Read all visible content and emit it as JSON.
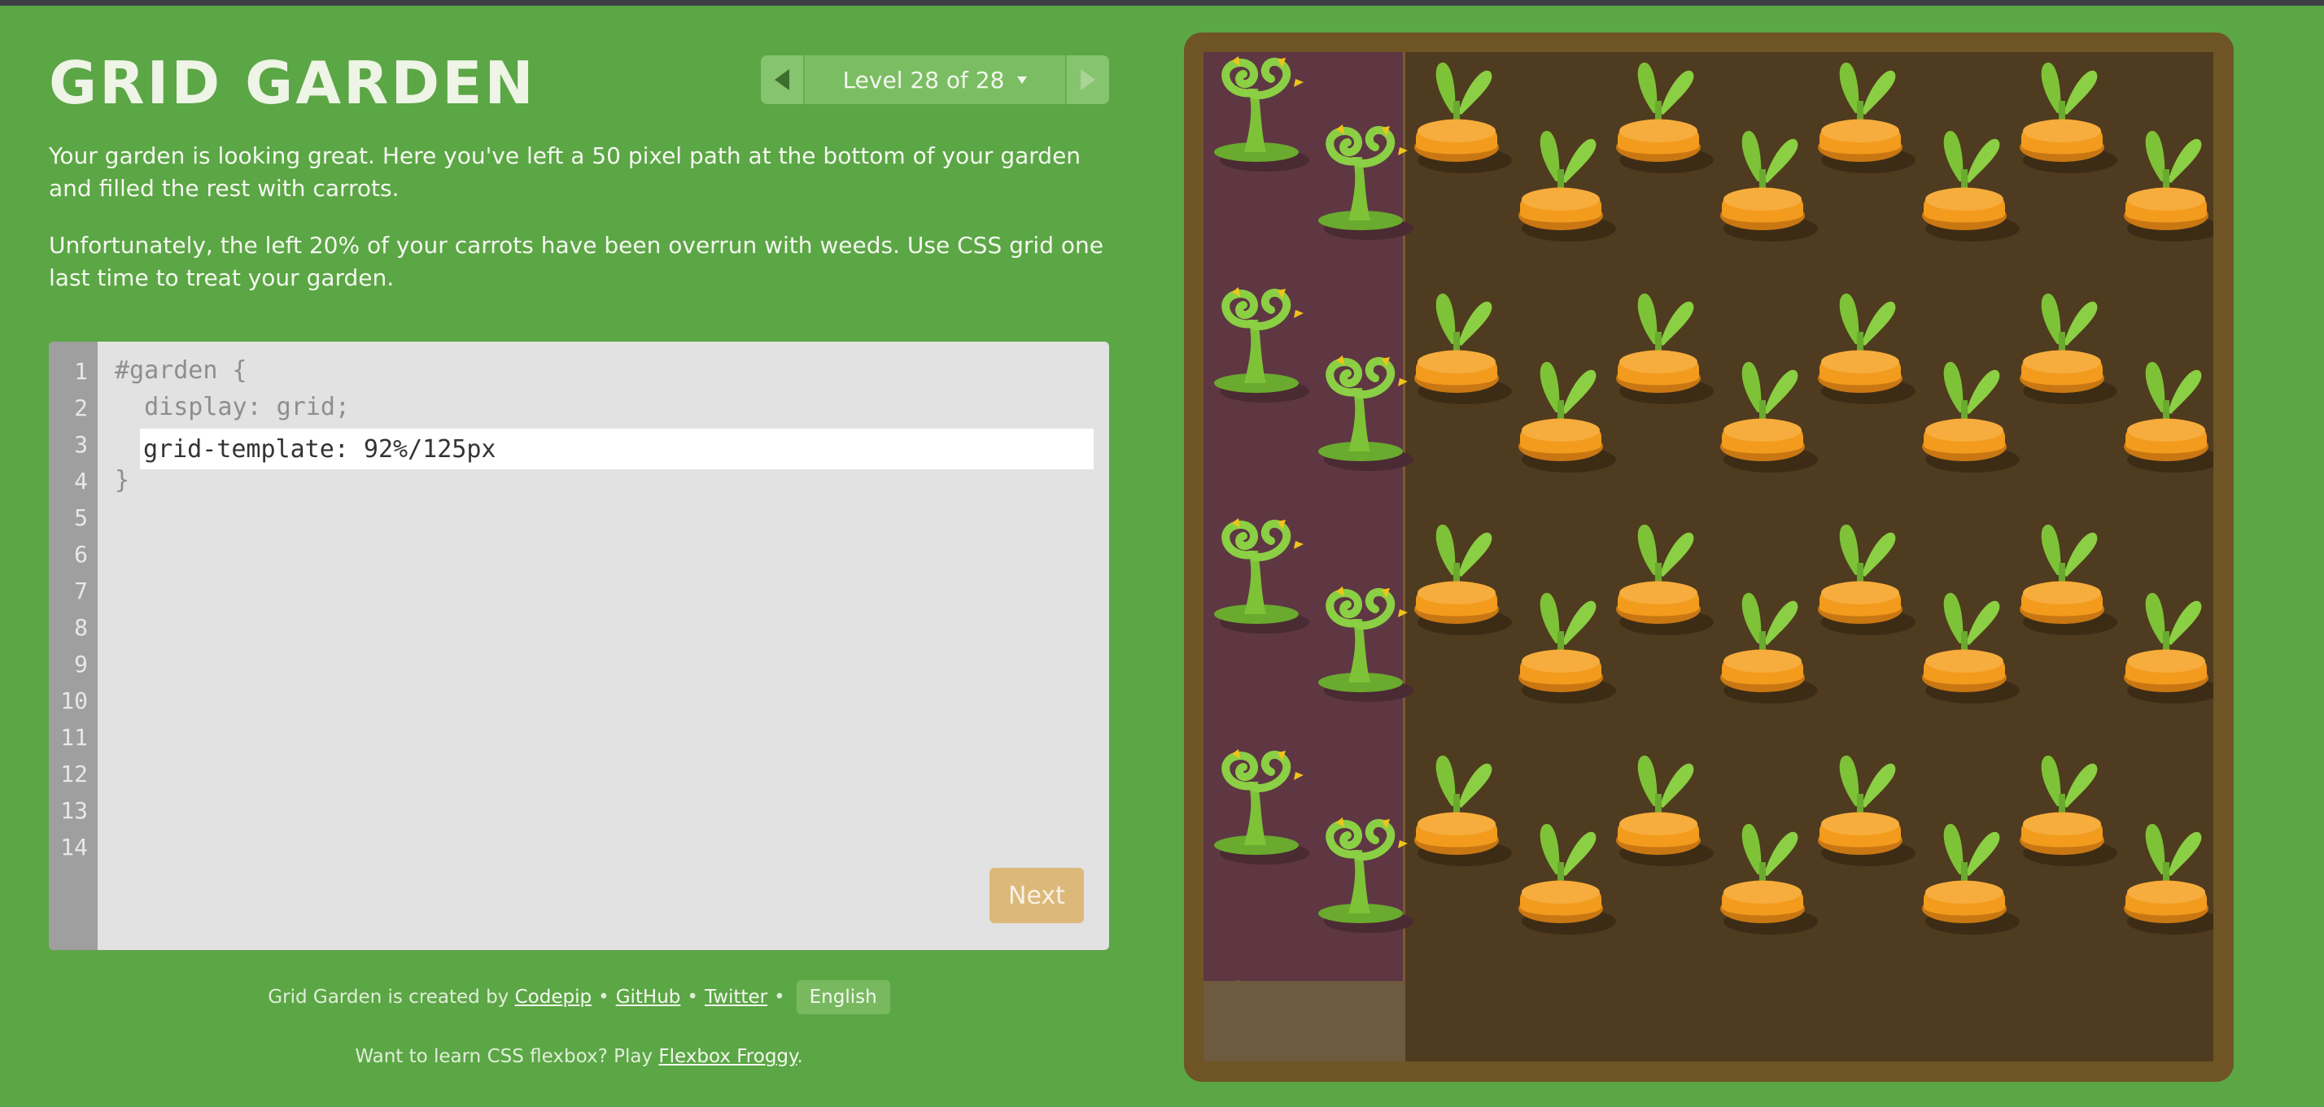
{
  "app": {
    "title": "GRID GARDEN",
    "level_label": "Level 28 of 28"
  },
  "instructions": [
    "Your garden is looking great. Here you've left a 50 pixel path at the bottom of your garden and filled the rest with carrots.",
    "Unfortunately, the left 20% of your carrots have been overrun with weeds. Use CSS grid one last time to treat your garden."
  ],
  "editor": {
    "line_numbers": [
      "1",
      "2",
      "3",
      "4",
      "5",
      "6",
      "7",
      "8",
      "9",
      "10",
      "11",
      "12",
      "13",
      "14"
    ],
    "line1": "#garden {",
    "line2": "  display: grid;",
    "input_value": "grid-template: 92%/125px",
    "line4": "}",
    "next_label": "Next"
  },
  "footer": {
    "created_by": "Grid Garden is created by",
    "codepip": "Codepip",
    "github": "GitHub",
    "twitter": "Twitter",
    "separator": "•",
    "language": "English",
    "flexbox_prompt": "Want to learn CSS flexbox? Play",
    "flexbox_link": "Flexbox Froggy",
    "period": "."
  },
  "colors": {
    "background": "#5ba645",
    "soil": "#4f3b1f",
    "weed_soil": "#5e3743",
    "frame": "#6f5425",
    "carrot": "#f29b1d",
    "leaf": "#7ec238"
  }
}
